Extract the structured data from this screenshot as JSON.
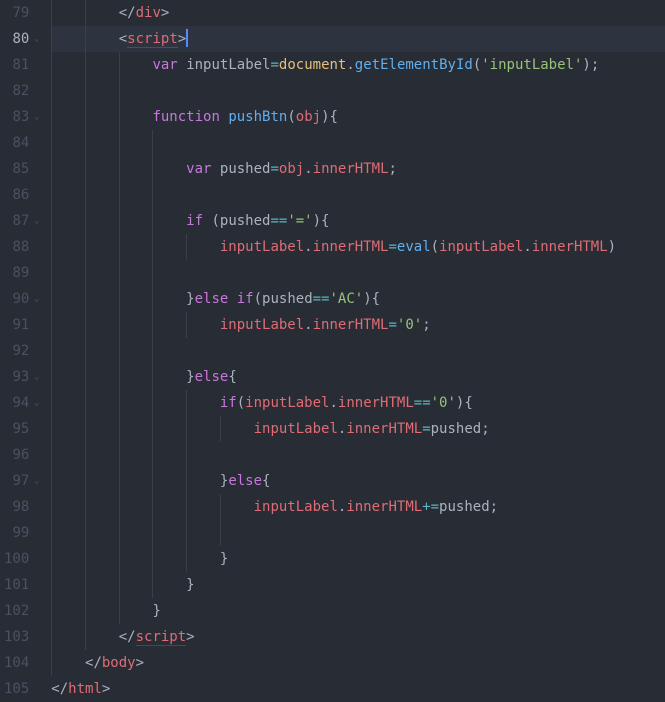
{
  "editor": {
    "theme": "one-dark",
    "first_line_number": 79,
    "current_line_number": 80,
    "lines": [
      {
        "num": 79,
        "indent_guides": [
          0,
          1
        ],
        "tokens": [
          {
            "cls": "t-plain",
            "text": "        "
          },
          {
            "cls": "t-angle",
            "text": "</"
          },
          {
            "cls": "t-tag",
            "text": "div"
          },
          {
            "cls": "t-angle",
            "text": ">"
          }
        ]
      },
      {
        "num": 80,
        "current": true,
        "fold": true,
        "indent_guides": [
          0,
          1
        ],
        "tokens": [
          {
            "cls": "t-plain",
            "text": "        "
          },
          {
            "cls": "t-angle",
            "text": "<"
          },
          {
            "cls": "t-tag underline",
            "text": "script"
          },
          {
            "cls": "t-angle",
            "text": ">"
          }
        ],
        "cursor_after": true
      },
      {
        "num": 81,
        "indent_guides": [
          0,
          1,
          2
        ],
        "tokens": [
          {
            "cls": "t-plain",
            "text": "            "
          },
          {
            "cls": "t-key",
            "text": "var"
          },
          {
            "cls": "t-plain",
            "text": " "
          },
          {
            "cls": "t-plain",
            "text": "inputLabel"
          },
          {
            "cls": "t-op",
            "text": "="
          },
          {
            "cls": "t-obj",
            "text": "document"
          },
          {
            "cls": "t-punct",
            "text": "."
          },
          {
            "cls": "t-fn",
            "text": "getElementById"
          },
          {
            "cls": "t-punct",
            "text": "("
          },
          {
            "cls": "t-str",
            "text": "'inputLabel'"
          },
          {
            "cls": "t-punct",
            "text": ");"
          }
        ]
      },
      {
        "num": 82,
        "indent_guides": [
          0,
          1,
          2
        ],
        "tokens": []
      },
      {
        "num": 83,
        "fold": true,
        "indent_guides": [
          0,
          1,
          2
        ],
        "tokens": [
          {
            "cls": "t-plain",
            "text": "            "
          },
          {
            "cls": "t-key",
            "text": "function"
          },
          {
            "cls": "t-plain",
            "text": " "
          },
          {
            "cls": "t-fn",
            "text": "pushBtn"
          },
          {
            "cls": "t-punct",
            "text": "("
          },
          {
            "cls": "t-var",
            "text": "obj"
          },
          {
            "cls": "t-punct",
            "text": "){"
          }
        ]
      },
      {
        "num": 84,
        "indent_guides": [
          0,
          1,
          2,
          3
        ],
        "tokens": []
      },
      {
        "num": 85,
        "indent_guides": [
          0,
          1,
          2,
          3
        ],
        "tokens": [
          {
            "cls": "t-plain",
            "text": "                "
          },
          {
            "cls": "t-key",
            "text": "var"
          },
          {
            "cls": "t-plain",
            "text": " "
          },
          {
            "cls": "t-plain",
            "text": "pushed"
          },
          {
            "cls": "t-op",
            "text": "="
          },
          {
            "cls": "t-var",
            "text": "obj"
          },
          {
            "cls": "t-punct",
            "text": "."
          },
          {
            "cls": "t-prop",
            "text": "innerHTML"
          },
          {
            "cls": "t-punct",
            "text": ";"
          }
        ]
      },
      {
        "num": 86,
        "indent_guides": [
          0,
          1,
          2,
          3
        ],
        "tokens": []
      },
      {
        "num": 87,
        "fold": true,
        "indent_guides": [
          0,
          1,
          2,
          3
        ],
        "tokens": [
          {
            "cls": "t-plain",
            "text": "                "
          },
          {
            "cls": "t-key",
            "text": "if"
          },
          {
            "cls": "t-plain",
            "text": " "
          },
          {
            "cls": "t-punct",
            "text": "("
          },
          {
            "cls": "t-plain",
            "text": "pushed"
          },
          {
            "cls": "t-op",
            "text": "=="
          },
          {
            "cls": "t-str",
            "text": "'='"
          },
          {
            "cls": "t-punct",
            "text": "){"
          }
        ]
      },
      {
        "num": 88,
        "indent_guides": [
          0,
          1,
          2,
          3,
          4
        ],
        "tokens": [
          {
            "cls": "t-plain",
            "text": "                    "
          },
          {
            "cls": "t-var",
            "text": "inputLabel"
          },
          {
            "cls": "t-punct",
            "text": "."
          },
          {
            "cls": "t-prop",
            "text": "innerHTML"
          },
          {
            "cls": "t-op",
            "text": "="
          },
          {
            "cls": "t-fn",
            "text": "eval"
          },
          {
            "cls": "t-punct",
            "text": "("
          },
          {
            "cls": "t-var",
            "text": "inputLabel"
          },
          {
            "cls": "t-punct",
            "text": "."
          },
          {
            "cls": "t-prop",
            "text": "innerHTML"
          },
          {
            "cls": "t-punct",
            "text": ")"
          }
        ]
      },
      {
        "num": 89,
        "indent_guides": [
          0,
          1,
          2,
          3
        ],
        "tokens": []
      },
      {
        "num": 90,
        "fold": true,
        "indent_guides": [
          0,
          1,
          2,
          3
        ],
        "tokens": [
          {
            "cls": "t-plain",
            "text": "                "
          },
          {
            "cls": "t-punct",
            "text": "}"
          },
          {
            "cls": "t-key",
            "text": "else"
          },
          {
            "cls": "t-plain",
            "text": " "
          },
          {
            "cls": "t-key",
            "text": "if"
          },
          {
            "cls": "t-punct",
            "text": "("
          },
          {
            "cls": "t-plain",
            "text": "pushed"
          },
          {
            "cls": "t-op",
            "text": "=="
          },
          {
            "cls": "t-str",
            "text": "'AC'"
          },
          {
            "cls": "t-punct",
            "text": "){"
          }
        ]
      },
      {
        "num": 91,
        "indent_guides": [
          0,
          1,
          2,
          3,
          4
        ],
        "tokens": [
          {
            "cls": "t-plain",
            "text": "                    "
          },
          {
            "cls": "t-var",
            "text": "inputLabel"
          },
          {
            "cls": "t-punct",
            "text": "."
          },
          {
            "cls": "t-prop",
            "text": "innerHTML"
          },
          {
            "cls": "t-op",
            "text": "="
          },
          {
            "cls": "t-str",
            "text": "'0'"
          },
          {
            "cls": "t-punct",
            "text": ";"
          }
        ]
      },
      {
        "num": 92,
        "indent_guides": [
          0,
          1,
          2,
          3
        ],
        "tokens": []
      },
      {
        "num": 93,
        "fold": true,
        "indent_guides": [
          0,
          1,
          2,
          3
        ],
        "tokens": [
          {
            "cls": "t-plain",
            "text": "                "
          },
          {
            "cls": "t-punct",
            "text": "}"
          },
          {
            "cls": "t-key",
            "text": "else"
          },
          {
            "cls": "t-punct",
            "text": "{"
          }
        ]
      },
      {
        "num": 94,
        "fold": true,
        "indent_guides": [
          0,
          1,
          2,
          3,
          4
        ],
        "tokens": [
          {
            "cls": "t-plain",
            "text": "                    "
          },
          {
            "cls": "t-key",
            "text": "if"
          },
          {
            "cls": "t-punct",
            "text": "("
          },
          {
            "cls": "t-var",
            "text": "inputLabel"
          },
          {
            "cls": "t-punct",
            "text": "."
          },
          {
            "cls": "t-prop",
            "text": "innerHTML"
          },
          {
            "cls": "t-op",
            "text": "=="
          },
          {
            "cls": "t-str",
            "text": "'0'"
          },
          {
            "cls": "t-punct",
            "text": "){"
          }
        ]
      },
      {
        "num": 95,
        "indent_guides": [
          0,
          1,
          2,
          3,
          4,
          5
        ],
        "tokens": [
          {
            "cls": "t-plain",
            "text": "                        "
          },
          {
            "cls": "t-var",
            "text": "inputLabel"
          },
          {
            "cls": "t-punct",
            "text": "."
          },
          {
            "cls": "t-prop",
            "text": "innerHTML"
          },
          {
            "cls": "t-op",
            "text": "="
          },
          {
            "cls": "t-plain",
            "text": "pushed;"
          }
        ]
      },
      {
        "num": 96,
        "indent_guides": [
          0,
          1,
          2,
          3,
          4
        ],
        "tokens": []
      },
      {
        "num": 97,
        "fold": true,
        "indent_guides": [
          0,
          1,
          2,
          3,
          4
        ],
        "tokens": [
          {
            "cls": "t-plain",
            "text": "                    "
          },
          {
            "cls": "t-punct",
            "text": "}"
          },
          {
            "cls": "t-key",
            "text": "else"
          },
          {
            "cls": "t-punct",
            "text": "{"
          }
        ]
      },
      {
        "num": 98,
        "indent_guides": [
          0,
          1,
          2,
          3,
          4,
          5
        ],
        "tokens": [
          {
            "cls": "t-plain",
            "text": "                        "
          },
          {
            "cls": "t-var",
            "text": "inputLabel"
          },
          {
            "cls": "t-punct",
            "text": "."
          },
          {
            "cls": "t-prop",
            "text": "innerHTML"
          },
          {
            "cls": "t-op",
            "text": "+="
          },
          {
            "cls": "t-plain",
            "text": "pushed;"
          }
        ]
      },
      {
        "num": 99,
        "indent_guides": [
          0,
          1,
          2,
          3,
          4,
          5
        ],
        "tokens": []
      },
      {
        "num": 100,
        "indent_guides": [
          0,
          1,
          2,
          3,
          4
        ],
        "tokens": [
          {
            "cls": "t-plain",
            "text": "                    "
          },
          {
            "cls": "t-punct",
            "text": "}"
          }
        ]
      },
      {
        "num": 101,
        "indent_guides": [
          0,
          1,
          2,
          3
        ],
        "tokens": [
          {
            "cls": "t-plain",
            "text": "                "
          },
          {
            "cls": "t-punct",
            "text": "}"
          }
        ]
      },
      {
        "num": 102,
        "indent_guides": [
          0,
          1,
          2
        ],
        "tokens": [
          {
            "cls": "t-plain",
            "text": "            "
          },
          {
            "cls": "t-punct",
            "text": "}"
          }
        ]
      },
      {
        "num": 103,
        "indent_guides": [
          0,
          1
        ],
        "tokens": [
          {
            "cls": "t-plain",
            "text": "        "
          },
          {
            "cls": "t-angle",
            "text": "</"
          },
          {
            "cls": "t-tag underline",
            "text": "script"
          },
          {
            "cls": "t-angle",
            "text": ">"
          }
        ]
      },
      {
        "num": 104,
        "indent_guides": [
          0
        ],
        "tokens": [
          {
            "cls": "t-plain",
            "text": "    "
          },
          {
            "cls": "t-angle",
            "text": "</"
          },
          {
            "cls": "t-tag",
            "text": "body"
          },
          {
            "cls": "t-angle",
            "text": ">"
          }
        ]
      },
      {
        "num": 105,
        "indent_guides": [],
        "tokens": [
          {
            "cls": "t-angle",
            "text": "</"
          },
          {
            "cls": "t-tag",
            "text": "html"
          },
          {
            "cls": "t-angle",
            "text": ">"
          }
        ]
      }
    ]
  }
}
